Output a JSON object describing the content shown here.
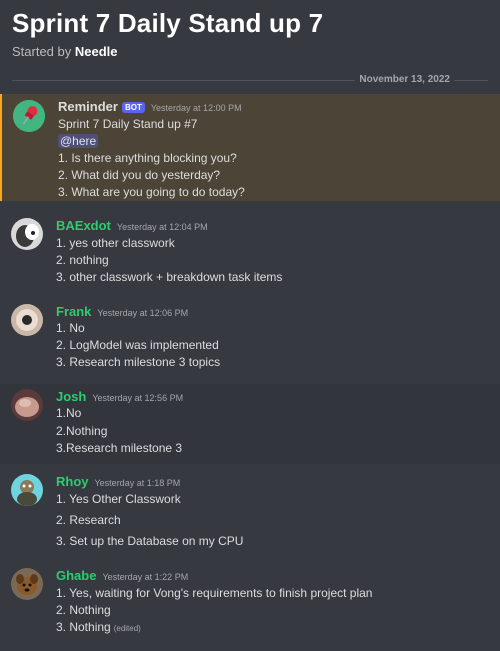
{
  "thread": {
    "title": "Sprint 7 Daily Stand up 7",
    "started_by_prefix": "Started by",
    "started_by_user": "Needle"
  },
  "date_divider": "November 13, 2022",
  "messages": [
    {
      "author": "Reminder",
      "author_color": "#ffffff",
      "bot_tag": "BOT",
      "timestamp": "Yesterday at 12:00 PM",
      "lines": [
        "Sprint 7 Daily Stand up #7",
        "@here",
        "1. Is there anything blocking you?",
        "2. What did you do yesterday?",
        "3. What are you going to do today?"
      ]
    },
    {
      "author": "BAExdot",
      "author_color": "#2ecc71",
      "timestamp": "Yesterday at 12:04 PM",
      "lines": [
        "1. yes other classwork",
        "2. nothing",
        "3. other classwork + breakdown task items"
      ]
    },
    {
      "author": "Frank",
      "author_color": "#2ecc71",
      "timestamp": "Yesterday at 12:06 PM",
      "lines": [
        "1. No",
        "2. LogModel was implemented",
        "3. Research milestone 3 topics"
      ]
    },
    {
      "author": "Josh",
      "author_color": "#2ecc71",
      "timestamp": "Yesterday at 12:56 PM",
      "lines": [
        "1.No",
        "2.Nothing",
        "3.Research milestone 3"
      ]
    },
    {
      "author": "Rhoy",
      "author_color": "#2ecc71",
      "timestamp": "Yesterday at 1:18 PM",
      "lines": [
        "1. Yes Other Classwork",
        "2. Research",
        "3. Set up the Database on my CPU"
      ]
    },
    {
      "author": "Ghabe",
      "author_color": "#2ecc71",
      "timestamp": "Yesterday at 1:22 PM",
      "lines": [
        "1. Yes, waiting for Vong's requirements to finish project plan",
        "2. Nothing",
        "3. Nothing"
      ],
      "edited_label": "(edited)"
    }
  ],
  "icons": {
    "reminder_avatar": "pushpin-icon"
  }
}
